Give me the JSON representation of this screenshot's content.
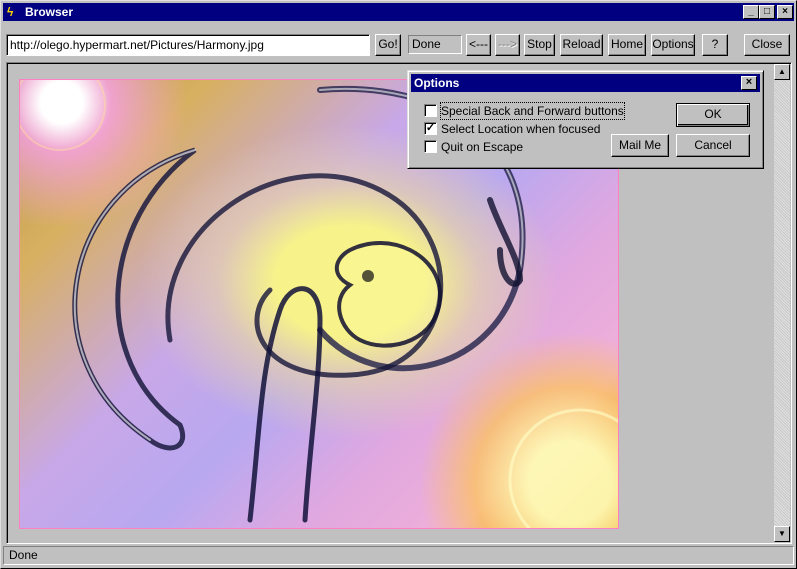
{
  "window": {
    "title": "Browser",
    "controls": {
      "minimize": "_",
      "maximize": "□",
      "close": "×"
    }
  },
  "toolbar": {
    "address_value": "http://olego.hypermart.net/Pictures/Harmony.jpg",
    "go_label": "Go!",
    "status_label": "Done",
    "back_label": "<---",
    "forward_label": "--->",
    "stop_label": "Stop",
    "reload_label": "Reload",
    "home_label": "Home",
    "options_label": "Options",
    "help_label": "?",
    "close_label": "Close"
  },
  "content": {
    "image_name": "Harmony.jpg"
  },
  "scrollbar": {
    "up": "▲",
    "down": "▼"
  },
  "statusbar": {
    "text": "Done"
  },
  "options_dialog": {
    "title": "Options",
    "close": "×",
    "checkboxes": [
      {
        "label": "Special Back and Forward buttons",
        "checked": false
      },
      {
        "label": "Select Location when focused",
        "checked": true
      },
      {
        "label": "Quit on Escape",
        "checked": false
      }
    ],
    "ok_label": "OK",
    "cancel_label": "Cancel",
    "mail_label": "Mail Me"
  },
  "colors": {
    "titlebar": "#000080",
    "face": "#c0c0c0"
  }
}
